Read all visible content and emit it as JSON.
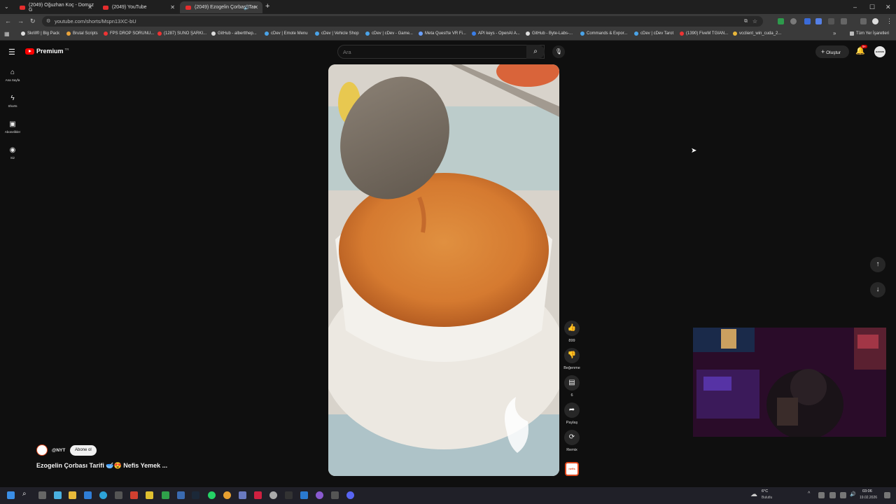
{
  "tabs": [
    {
      "title": "(2049) Oğuzhan Koç - Domuz G",
      "close": "✕"
    },
    {
      "title": "(2049) YouTube",
      "close": "✕"
    },
    {
      "title": "(2049) Ezogelin Çorbası Tar",
      "close": "✕"
    }
  ],
  "new_tab": "+",
  "window_controls": {
    "minimize": "–",
    "maximize": "☐",
    "close": "✕"
  },
  "url": "youtube.com/shorts/Mspn13XC-bU",
  "bookmarks": [
    "Skrill® | Big Pack",
    "Brutal Scripts",
    "FPS DROP SORUNU...",
    "(1287) SUNO ŞARKI...",
    "GitHub - albertthep...",
    "cDev | Emote Menu",
    "cDev | Vehicle Shop",
    "cDev | cDev - Game...",
    "Meta Quest'te VR Fi...",
    "API keys - OpenAI A...",
    "GitHub - Byte-Labs-...",
    "Commands & Expor...",
    "cDev | cDev Tarot",
    "(1390) FiveM TGIAN...",
    "vcclient_win_cuda_2..."
  ],
  "bookmarks_more": "»",
  "all_bookmarks": "Tüm Yer İşaretleri",
  "yt": {
    "logo": "Premium",
    "logo_region": "TR",
    "search_placeholder": "Ara",
    "create_label": "Oluştur",
    "notif_count": "9+",
    "avatar_text": "BAKIMO",
    "sidebar": [
      {
        "label": "Ana Sayfa",
        "icon": "home-icon"
      },
      {
        "label": "Shorts",
        "icon": "shorts-icon"
      },
      {
        "label": "Abonelikler",
        "icon": "subscriptions-icon"
      },
      {
        "label": "Siz",
        "icon": "you-icon"
      }
    ],
    "channel": "@NYT",
    "subscribe": "Abone ol",
    "title": "Ezogelin Çorbası Tarifi 🥣😍 Nefis Yemek ...",
    "actions": {
      "like_count": "899",
      "dislike_label": "Beğenme",
      "comment_count": "6",
      "share_label": "Paylaş",
      "remix_label": "Remix"
    },
    "channel_thumb_text": "nefis"
  },
  "taskbar": {
    "weather_temp": "6°C",
    "weather_desc": "Bulutlu",
    "time": "03:06",
    "date": "19.02.2026"
  }
}
